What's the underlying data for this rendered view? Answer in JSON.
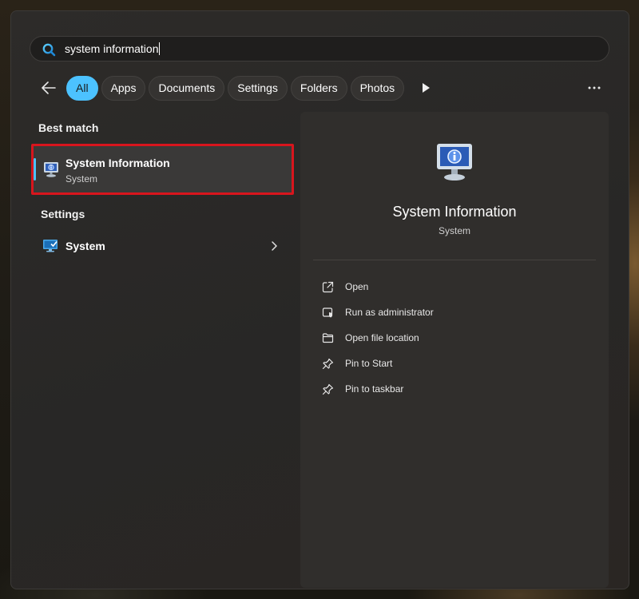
{
  "search": {
    "query": "system information",
    "icon": "search-icon"
  },
  "filters": {
    "back_icon": "back-arrow-icon",
    "chips": [
      {
        "label": "All",
        "active": true
      },
      {
        "label": "Apps",
        "active": false
      },
      {
        "label": "Documents",
        "active": false
      },
      {
        "label": "Settings",
        "active": false
      },
      {
        "label": "Folders",
        "active": false
      },
      {
        "label": "Photos",
        "active": false
      }
    ],
    "more_icon": "play-icon",
    "overflow_icon": "more-options-icon"
  },
  "results": {
    "best_match_heading": "Best match",
    "best_match": {
      "title": "System Information",
      "subtitle": "System",
      "icon": "system-information-icon"
    },
    "settings_heading": "Settings",
    "settings_item": {
      "label": "System",
      "icon": "system-settings-icon"
    }
  },
  "preview": {
    "title": "System Information",
    "subtitle": "System",
    "actions": [
      {
        "label": "Open",
        "icon": "open-icon"
      },
      {
        "label": "Run as administrator",
        "icon": "run-as-admin-icon"
      },
      {
        "label": "Open file location",
        "icon": "folder-icon"
      },
      {
        "label": "Pin to Start",
        "icon": "pin-icon"
      },
      {
        "label": "Pin to taskbar",
        "icon": "pin-icon"
      }
    ]
  },
  "colors": {
    "accent": "#4cc2ff",
    "highlight_border": "#d8151d",
    "panel": "#2b2a28"
  }
}
